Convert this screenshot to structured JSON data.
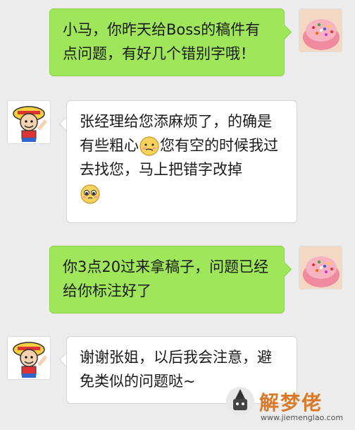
{
  "messages": [
    {
      "side": "sent",
      "avatar": "cake-avatar",
      "text": "小马，你昨天给Boss的稿件有点问题，有好几个错别字哦！"
    },
    {
      "side": "received",
      "avatar": "pirate-cartoon-avatar",
      "text_part1": "张经理给您添麻烦了，的确是有些粗心",
      "emoji1": "embarrassed-face-emoji",
      "text_part2": "您有空的时候我过去找您，马上把错字改掉",
      "emoji2": "pleading-face-emoji"
    },
    {
      "side": "sent",
      "avatar": "cake-avatar",
      "text": "你3点20过来拿稿子，问题已经给你标注好了"
    },
    {
      "side": "received",
      "avatar": "pirate-cartoon-avatar",
      "text": "谢谢张姐，以后我会注意，避免类似的问题哒~"
    }
  ],
  "watermark": {
    "name": "解梦佬",
    "url": "www.jiemenglao.com"
  },
  "colors": {
    "background": "#ececec",
    "sent_bubble": "#9fe65a",
    "received_bubble": "#ffffff"
  }
}
